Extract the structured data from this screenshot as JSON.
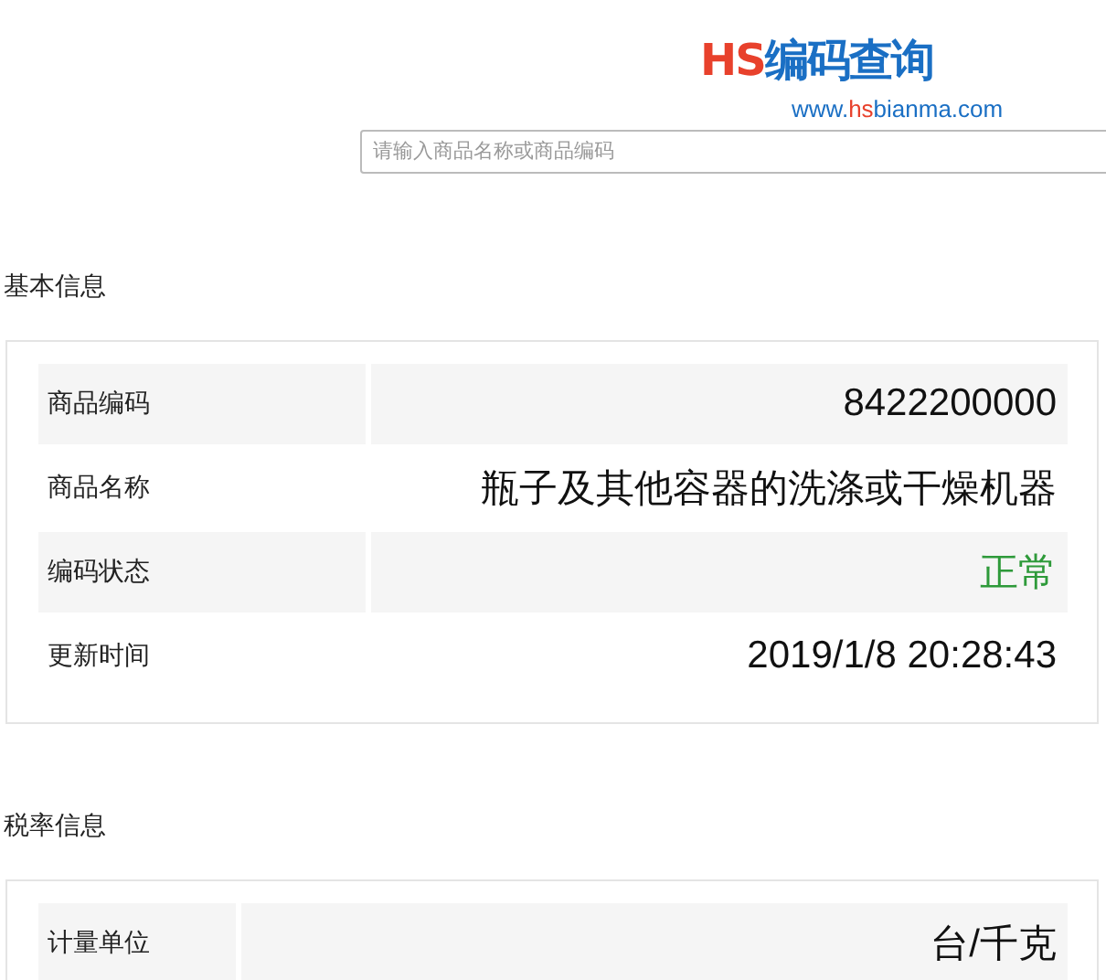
{
  "logo": {
    "parts": [
      {
        "text": "HS",
        "color": "#e8412c"
      },
      {
        "text": "编码查询",
        "color": "#1a6fc4"
      }
    ]
  },
  "site_url": {
    "parts": [
      {
        "text": "www.",
        "color": "#1a6fc4"
      },
      {
        "text": "hs",
        "color": "#e8412c"
      },
      {
        "text": "bianma.com",
        "color": "#1a6fc4"
      }
    ]
  },
  "search": {
    "placeholder": "请输入商品名称或商品编码"
  },
  "sections": [
    {
      "title": "基本信息",
      "kind": "wide",
      "rows": [
        {
          "label": "商品编码",
          "value": "8422200000",
          "kind": "text"
        },
        {
          "label": "商品名称",
          "value": "瓶子及其他容器的洗涤或干燥机器",
          "kind": "text"
        },
        {
          "label": "编码状态",
          "value": "正常",
          "kind": "status"
        },
        {
          "label": "更新时间",
          "value": "2019/1/8 20:28:43",
          "kind": "text"
        }
      ]
    },
    {
      "title": "税率信息",
      "kind": "narrow",
      "rows": [
        {
          "label": "计量单位",
          "value": "台/千克",
          "kind": "text"
        }
      ]
    }
  ]
}
